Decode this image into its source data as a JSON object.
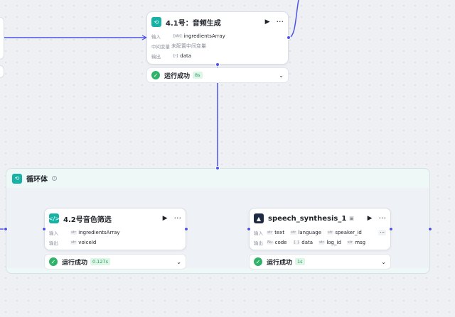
{
  "colors": {
    "edge": "#4d53e8",
    "success": "#2fb36b",
    "teal": "#16b2a6"
  },
  "audio_node": {
    "title": "4.1号：音频生成",
    "icon": "loop-icon",
    "input_label": "输入",
    "input_type": "[str]",
    "input_value": "ingredientsArray",
    "mid_label": "中间变量",
    "mid_value": "未配置中间变量",
    "output_label": "输出",
    "output_type": "[-]",
    "output_value": "data"
  },
  "audio_status": {
    "text": "运行成功",
    "time": "8s"
  },
  "loop_body": {
    "title": "循环体",
    "icon": "loop-icon"
  },
  "voice_node": {
    "title": "4.2号音色筛选",
    "icon": "code-icon",
    "input_label": "输入",
    "input_type": "str",
    "input_value": "ingredientsArray",
    "output_label": "输出",
    "output_type": "str",
    "output_value": "voiceId"
  },
  "voice_status": {
    "text": "运行成功",
    "time": "0.127s"
  },
  "speech_node": {
    "title": "speech_synthesis_1",
    "icon": "speech-plugin-icon",
    "input_label": "输入",
    "inputs": [
      {
        "type": "str",
        "name": "text"
      },
      {
        "type": "str",
        "name": "language"
      },
      {
        "type": "str",
        "name": "speaker_id"
      }
    ],
    "output_label": "输出",
    "outputs": [
      {
        "type": "Nu",
        "name": "code"
      },
      {
        "type": "{ }",
        "name": "data"
      },
      {
        "type": "str",
        "name": "log_id"
      },
      {
        "type": "str",
        "name": "msg"
      }
    ]
  },
  "speech_status": {
    "text": "运行成功",
    "time": "1s"
  }
}
